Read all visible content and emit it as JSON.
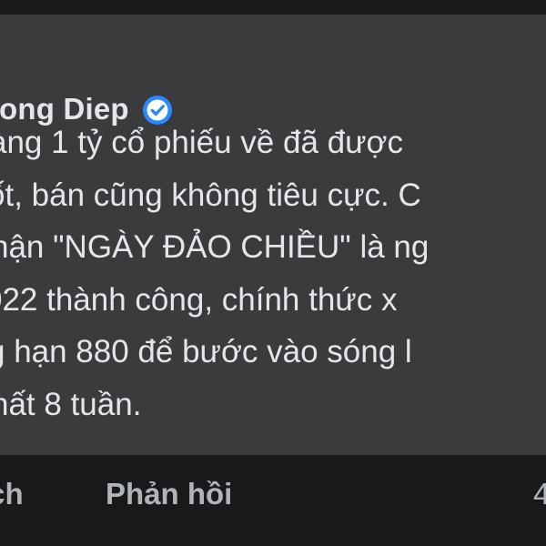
{
  "comment": {
    "author": "ong Diep",
    "verified": true,
    "lines": [
      "àng 1 tỷ cổ phiếu về đã được",
      "ốt, bán cũng không tiêu cực. C",
      "hận \"NGÀY ĐẢO CHIỀU\" là ng",
      "022 thành công, chính thức x",
      "g hạn 880 để bước vào sóng l",
      "hất 8 tuần."
    ]
  },
  "actions": {
    "like_label": "ích",
    "reply_label": "Phản hồi",
    "time_label": "4"
  },
  "colors": {
    "background": "#18191a",
    "bubble": "#3a3b3c",
    "text_primary": "#e4e6eb",
    "text_secondary": "#b0b3b8",
    "verified_badge": "#2d88ff"
  },
  "icons": {
    "verified": "verified-badge-icon"
  }
}
